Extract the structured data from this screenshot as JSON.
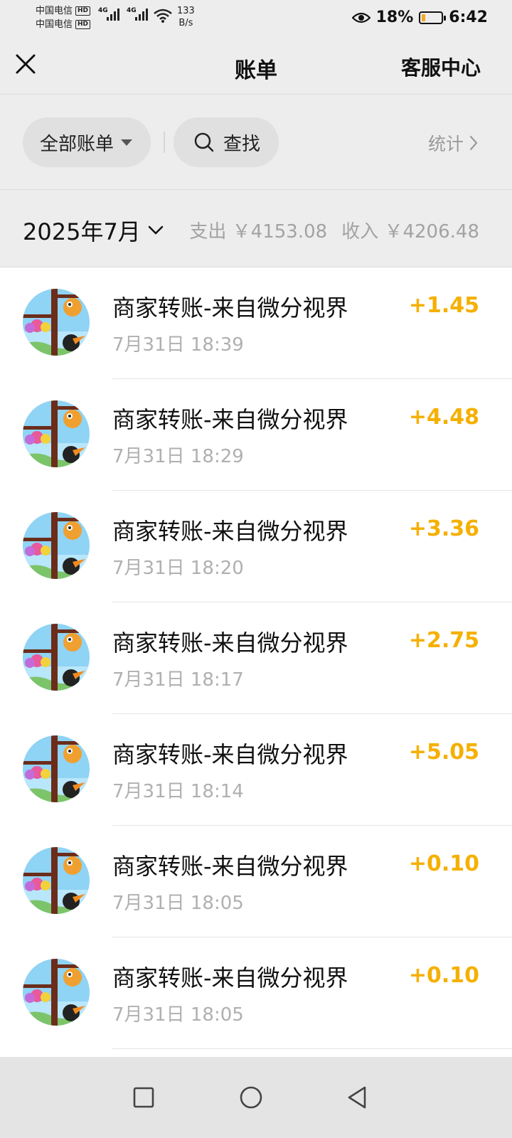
{
  "status_bar": {
    "carrier_1": "中国电信",
    "carrier_2": "中国电信",
    "hd_badge": "HD",
    "network_type": "4G",
    "net_speed_value": "133",
    "net_speed_unit": "B/s",
    "battery_percent": "18%",
    "battery_level": 0.18,
    "time": "6:42"
  },
  "header": {
    "title": "账单",
    "service_link": "客服中心"
  },
  "filter": {
    "all_bills_label": "全部账单",
    "search_label": "查找",
    "stats_label": "统计"
  },
  "month_summary": {
    "month": "2025年7月",
    "expense": "支出 ￥4153.08",
    "income": "收入 ￥4206.48"
  },
  "transactions": [
    {
      "title": "商家转账-来自微分视界",
      "time": "7月31日 18:39",
      "amount": "+1.45"
    },
    {
      "title": "商家转账-来自微分视界",
      "time": "7月31日 18:29",
      "amount": "+4.48"
    },
    {
      "title": "商家转账-来自微分视界",
      "time": "7月31日 18:20",
      "amount": "+3.36"
    },
    {
      "title": "商家转账-来自微分视界",
      "time": "7月31日 18:17",
      "amount": "+2.75"
    },
    {
      "title": "商家转账-来自微分视界",
      "time": "7月31日 18:14",
      "amount": "+5.05"
    },
    {
      "title": "商家转账-来自微分视界",
      "time": "7月31日 18:05",
      "amount": "+0.10"
    },
    {
      "title": "商家转账-来自微分视界",
      "time": "7月31日 18:05",
      "amount": "+0.10"
    }
  ],
  "colors": {
    "income_amount": "#f5b000",
    "background": "#ededed",
    "battery_low": "#f5a623"
  },
  "icons": {
    "close": "close-icon",
    "caret": "caret-down-icon",
    "search": "search-icon",
    "stats_chevron": "chevron-right-icon",
    "month_chevron": "chevron-down-icon",
    "nav_recents": "square-icon",
    "nav_home": "circle-icon",
    "nav_back": "triangle-back-icon"
  }
}
